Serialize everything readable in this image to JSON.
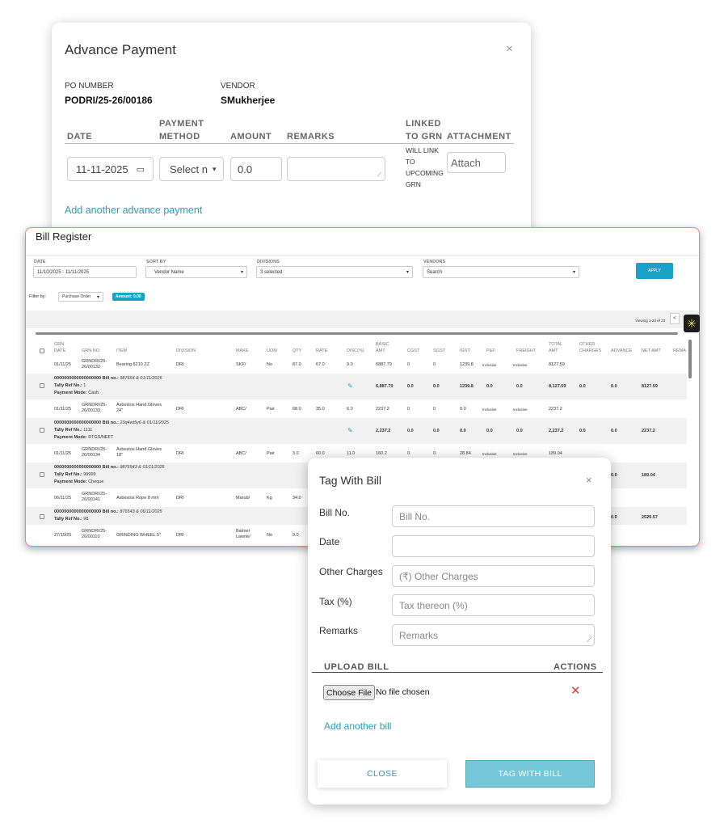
{
  "advance_payment": {
    "title": "Advance Payment",
    "close": "×",
    "po_label": "PO NUMBER",
    "po_value": "PODRI/25-26/00186",
    "vendor_label": "VENDOR",
    "vendor_value": "SMukherjee",
    "headers": {
      "date": "DATE",
      "payment_method_1": "PAYMENT",
      "payment_method_2": "METHOD",
      "amount": "AMOUNT",
      "remarks": "REMARKS",
      "linked_1": "LINKED",
      "linked_2": "TO GRN",
      "attachment": "ATTACHMENT"
    },
    "date_value": "11-11-2025",
    "payment_method_value": "Select n",
    "amount_value": "0.0",
    "remarks_value": "",
    "linked_lines": [
      "WILL LINK",
      "TO",
      "UPCOMING",
      "GRN"
    ],
    "attach_label": "Attach",
    "add_link": "Add another advance payment"
  },
  "bill_register": {
    "title": "Bill Register",
    "filters": {
      "date_label": "DATE",
      "date_value": "11/10/2025 - 11/11/2025",
      "sort_label": "SORT BY",
      "sort_value": "Vendor Name",
      "divisions_label": "DIVISIONS",
      "divisions_value": "3 selected",
      "vendors_label": "VENDORS",
      "vendors_value": "Search",
      "apply": "APPLY",
      "filter_by": "Filter by:",
      "filter_select": "Purchase Order",
      "amount_badge": "Amount: 0.00",
      "viewing": "Viewing 1-23 of 23",
      "prev": "<"
    },
    "headers": {
      "grn_date_1": "GRN",
      "grn_date_2": "DATE",
      "grn_no": "GRN NO.",
      "item": "ITEM",
      "division": "DIVISION",
      "make": "MAKE",
      "uom": "UOM",
      "qty": "QTY",
      "rate": "RATE",
      "disc": "DISC(%)",
      "basic_1": "BASIC",
      "basic_2": "AMT",
      "cgst": "CGST",
      "sgst": "SGST",
      "igst": "IGST",
      "pf": "P&F",
      "freight": "FREIGHT",
      "total_1": "TOTAL",
      "total_2": "AMT",
      "other_1": "OTHER",
      "other_2": "CHARGES",
      "advance": "ADVANCE",
      "net": "NET AMT",
      "remarks": "REMA"
    },
    "items": [
      {
        "date": "01/11/25",
        "grn1": "GRNDRI/25-",
        "grn2": "26/00132",
        "item1": "Bearing 6210 ZZ",
        "item2": "",
        "division": "DRI",
        "make1": "SKF/",
        "make2": "",
        "uom": "No",
        "qty": "87.0",
        "rate": "67.0",
        "disc": "9.0",
        "basic": "6887.79",
        "cgst": "0",
        "sgst": "0",
        "igst": "1239.8",
        "pf": "Inclusive",
        "freight": "Inclusive",
        "total": "8127.59"
      },
      {
        "date": "01/11/25",
        "grn1": "GRNDRI/25-",
        "grn2": "26/00133",
        "item1": "Asbestos Hand Gloves",
        "item2": "24\"",
        "division": "DRI",
        "make1": "ABC/",
        "make2": "",
        "uom": "Pair",
        "qty": "68.0",
        "rate": "35.0",
        "disc": "6.0",
        "basic": "2237.2",
        "cgst": "0",
        "sgst": "0",
        "igst": "0.0",
        "pf": "Inclusive",
        "freight": "Inclusive",
        "total": "2237.2"
      },
      {
        "date": "01/11/25",
        "grn1": "GRNDRI/25-",
        "grn2": "26/00134",
        "item1": "Asbestos Hand Gloves",
        "item2": "18\"",
        "division": "DRI",
        "make1": "ABC/",
        "make2": "",
        "uom": "Pair",
        "qty": "3.0",
        "rate": "60.0",
        "disc": "11.0",
        "basic": "160.2",
        "cgst": "0",
        "sgst": "0",
        "igst": "28.84",
        "pf": "Inclusive",
        "freight": "Inclusive",
        "total": "189.04"
      },
      {
        "date": "06/11/25",
        "grn1": "GRNDRI/25-",
        "grn2": "26/00141",
        "item1": "Asbestos Rope 8 mm",
        "item2": "",
        "division": "DRI",
        "make1": "Marub/",
        "make2": "",
        "uom": "Kg",
        "qty": "34.0",
        "rate": "",
        "disc": "",
        "basic": "",
        "cgst": "",
        "sgst": "",
        "igst": "",
        "pf": "",
        "freight": "",
        "total": ""
      },
      {
        "date": "27/10/25",
        "grn1": "GRNDRI/25-",
        "grn2": "26/00110",
        "item1": "GRINDING WHEEL 5\"",
        "item2": "",
        "division": "DRI",
        "make1": "Balmer",
        "make2": "Lawrie/",
        "uom": "No",
        "qty": "9.0",
        "rate": "",
        "disc": "",
        "basic": "",
        "cgst": "",
        "sgst": "",
        "igst": "",
        "pf": "",
        "freight": "",
        "total": ""
      }
    ],
    "bills": [
      {
        "line1": "0000000000000000000",
        "bill_label": "Bill no.:",
        "bill_value": "987654 & 01/11/2025",
        "tally_label": "Tally Ref No.:",
        "tally_value": "1",
        "mode_label": "Payment Mode:",
        "mode_value": "Cash",
        "basic": "6,887.79",
        "cgst": "0.0",
        "sgst": "0.0",
        "igst": "1239.8",
        "pf": "0.0",
        "freight": "0.0",
        "total": "8,127.59",
        "other": "0.0",
        "advance": "0.0",
        "net": "8127.59"
      },
      {
        "line1": "0000000000000000000",
        "bill_label": "Bill no.:",
        "bill_value": "23q4wt5y6 & 01/11/2025",
        "tally_label": "Tally Ref No.:",
        "tally_value": "1111",
        "mode_label": "Payment Mode:",
        "mode_value": "RTGS/NEFT",
        "basic": "2,237.2",
        "cgst": "0.0",
        "sgst": "0.0",
        "igst": "0.0",
        "pf": "0.0",
        "freight": "0.0",
        "total": "2,237.2",
        "other": "0.0",
        "advance": "0.0",
        "net": "2237.2"
      },
      {
        "line1": "0000000000000000000",
        "bill_label": "Bill no.:",
        "bill_value": "9876543 & 01/11/2025",
        "tally_label": "Tally Ref No.:",
        "tally_value": "99999",
        "mode_label": "Payment Mode:",
        "mode_value": "Cheque",
        "advance": "0.0",
        "net": "189.04"
      },
      {
        "line1": "0000000000000000000",
        "bill_label": "Bill no.:",
        "bill_value": "876543 & 06/11/2025",
        "tally_label": "Tally Ref No.:",
        "tally_value": "98",
        "mode_label": "",
        "mode_value": "",
        "advance": "0.0",
        "net": "2529.57"
      }
    ]
  },
  "tag_with_bill": {
    "title": "Tag With Bill",
    "close": "×",
    "fields": {
      "bill_no_label": "Bill No.",
      "bill_no_placeholder": "Bill No.",
      "date_label": "Date",
      "other_label": "Other Charges",
      "other_placeholder": "(₹) Other Charges",
      "tax_label": "Tax (%)",
      "tax_placeholder": "Tax thereon (%)",
      "remarks_label": "Remarks",
      "remarks_placeholder": "Remarks"
    },
    "upload_header": "UPLOAD BILL",
    "actions_header": "ACTIONS",
    "choose_file": "Choose File",
    "no_file": "No file chosen",
    "delete": "✕",
    "add_bill": "Add another bill",
    "close_button": "CLOSE",
    "tag_button": "TAG WITH BILL"
  },
  "colors": {
    "accent": "#1aa3c6",
    "link": "#2a9cb8",
    "bill_border": "#e8896a",
    "danger": "#e03a3a"
  }
}
